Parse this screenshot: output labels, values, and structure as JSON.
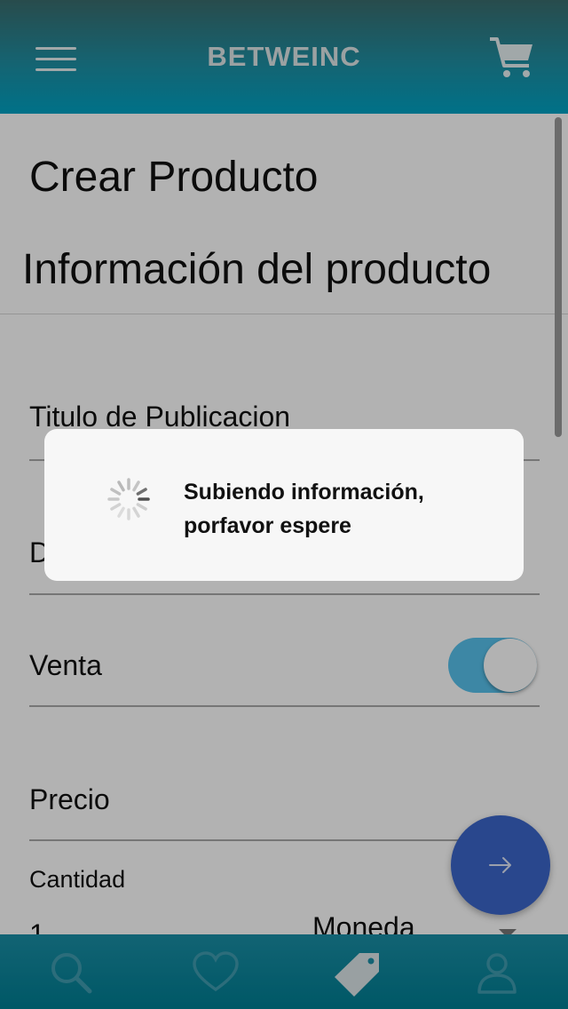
{
  "header": {
    "title": "BETWEINC",
    "menu_icon": "hamburger-menu-icon",
    "cart_icon": "shopping-cart-icon"
  },
  "page": {
    "title": "Crear Producto",
    "section_title": "Información del producto"
  },
  "form": {
    "title_label": "Titulo de Publicacion",
    "description_label": "D",
    "sale_label": "Venta",
    "sale_enabled": true,
    "price_label": "Precio",
    "quantity_label": "Cantidad",
    "quantity_value": "1",
    "currency_label": "Moneda"
  },
  "fab": {
    "icon": "arrow-right-icon"
  },
  "bottom_nav": {
    "items": [
      {
        "icon": "search-icon"
      },
      {
        "icon": "heart-icon"
      },
      {
        "icon": "tag-icon"
      },
      {
        "icon": "user-icon"
      }
    ]
  },
  "dialog": {
    "message": "Subiendo información, porfavor espere"
  },
  "colors": {
    "header_top": "#3a6d6e",
    "header_bottom": "#00a3c4",
    "toggle_on": "#58c2ec",
    "fab": "#3b66cb",
    "nav_bg": "#007e93"
  }
}
